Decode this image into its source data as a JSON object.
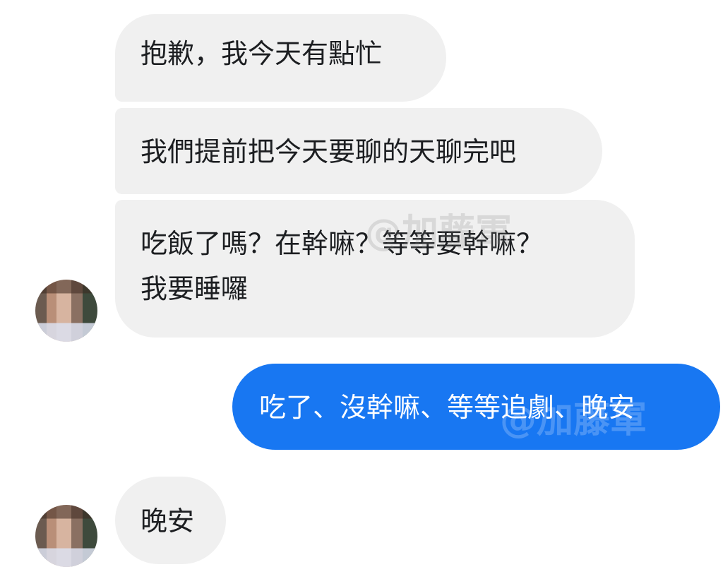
{
  "chat": {
    "messages": [
      {
        "direction": "incoming",
        "text": "抱歉，我今天有點忙"
      },
      {
        "direction": "incoming",
        "text": "我們提前把今天要聊的天聊完吧"
      },
      {
        "direction": "incoming",
        "lines": [
          "吃飯了嗎？在幹嘛？等等要幹嘛？",
          "我要睡囉"
        ]
      },
      {
        "direction": "outgoing",
        "text": "吃了、沒幹嘛、等等追劇、晚安"
      },
      {
        "direction": "incoming",
        "text": "晚安"
      }
    ]
  },
  "watermark": {
    "text": "@加藤軍"
  },
  "colors": {
    "incoming_bubble": "#f0f0f0",
    "outgoing_bubble": "#1877f2",
    "incoming_text": "#1c1e21",
    "outgoing_text": "#ffffff",
    "background": "#ffffff"
  }
}
